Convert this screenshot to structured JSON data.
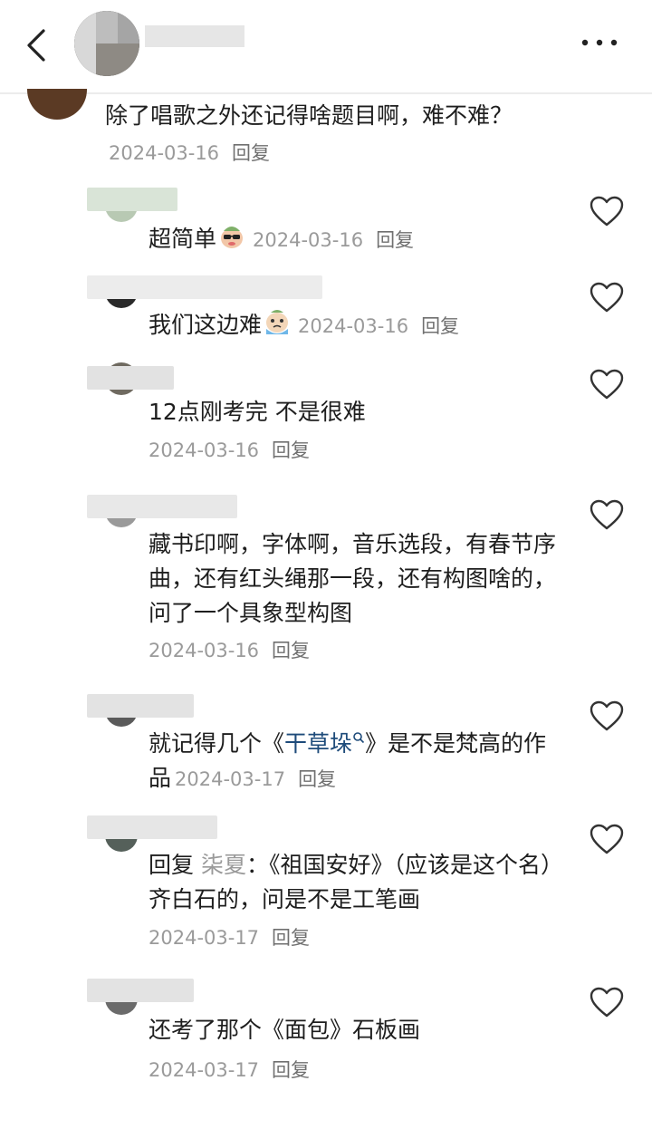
{
  "header": {
    "back_icon": "chevron-left-icon",
    "more_icon": "more-dots-icon"
  },
  "main_comment": {
    "text": "除了唱歌之外还记得啥题目啊，难不难？",
    "date": "2024-03-16",
    "reply_label": "回复"
  },
  "comments": [
    {
      "text": "超简单",
      "emoji": "sunglasses-face-emoji",
      "date": "2024-03-16",
      "reply_label": "回复"
    },
    {
      "text": "我们这边难",
      "emoji": "crying-face-emoji",
      "date": "2024-03-16",
      "reply_label": "回复"
    },
    {
      "text": "12点刚考完 不是很难",
      "date": "2024-03-16",
      "reply_label": "回复"
    },
    {
      "text": "藏书印啊，字体啊，音乐选段，有春节序曲，还有红头绳那一段，还有构图啥的，问了一个具象型构图",
      "date": "2024-03-16",
      "reply_label": "回复"
    },
    {
      "text_before": "就记得几个《",
      "link": "干草垛",
      "text_after": "》是不是梵高的作品",
      "date": "2024-03-17",
      "reply_label": "回复"
    },
    {
      "reply_prefix": "回复",
      "reply_to": "柒夏",
      "text": "：《祖国安好》（应该是这个名）齐白石的，问是不是工笔画",
      "date": "2024-03-17",
      "reply_label": "回复"
    },
    {
      "text": "还考了那个《面包》石板画",
      "date": "2024-03-17",
      "reply_label": "回复"
    }
  ],
  "colors": {
    "date": "#9a9a9a",
    "reply": "#707070",
    "link": "#1e4b7a"
  }
}
